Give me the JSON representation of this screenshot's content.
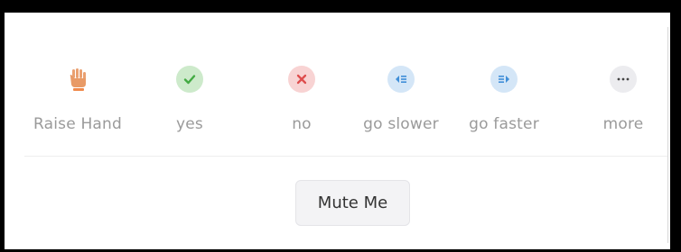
{
  "reactions": {
    "items": [
      {
        "label": "Raise Hand",
        "icon": "raise-hand-icon",
        "color": "#e8a072",
        "bg": "transparent"
      },
      {
        "label": "yes",
        "icon": "check-icon",
        "color": "#4fb64f",
        "bg": "#cdeacb"
      },
      {
        "label": "no",
        "icon": "x-icon",
        "color": "#e05252",
        "bg": "#f8d3d3"
      },
      {
        "label": "go slower",
        "icon": "go-slower-icon",
        "color": "#3f8ed8",
        "bg": "#d4e6f7"
      },
      {
        "label": "go faster",
        "icon": "go-faster-icon",
        "color": "#3f8ed8",
        "bg": "#d4e6f7"
      },
      {
        "label": "more",
        "icon": "more-icon",
        "color": "#555555",
        "bg": "#ececef"
      }
    ]
  },
  "mute_button": {
    "label": "Mute Me"
  }
}
